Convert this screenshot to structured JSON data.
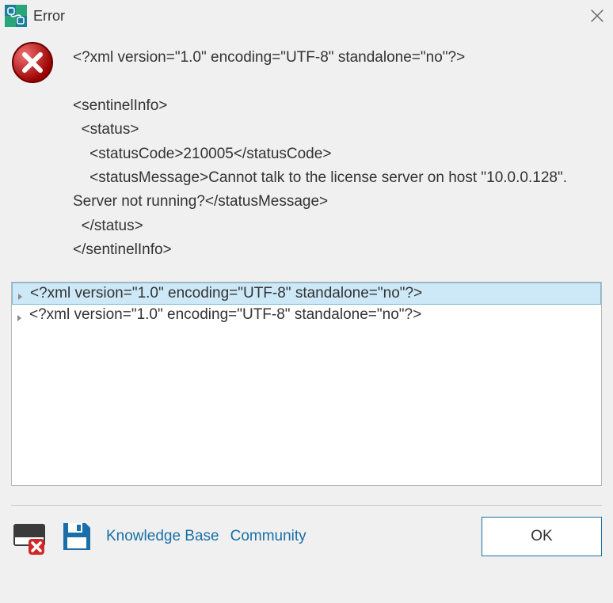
{
  "title": "Error",
  "message": "<?xml version=\"1.0\" encoding=\"UTF-8\" standalone=\"no\"?>\n\n<sentinelInfo>\n  <status>\n    <statusCode>210005</statusCode>\n    <statusMessage>Cannot talk to the license server on host \"10.0.0.128\". Server not running?</statusMessage>\n  </status>\n</sentinelInfo>",
  "rows": [
    {
      "text": "<?xml version=\"1.0\" encoding=\"UTF-8\" standalone=\"no\"?>",
      "selected": true
    },
    {
      "text": "<?xml version=\"1.0\" encoding=\"UTF-8\" standalone=\"no\"?>",
      "selected": false
    }
  ],
  "links": {
    "kb": "Knowledge Base",
    "community": "Community"
  },
  "ok_label": "OK"
}
